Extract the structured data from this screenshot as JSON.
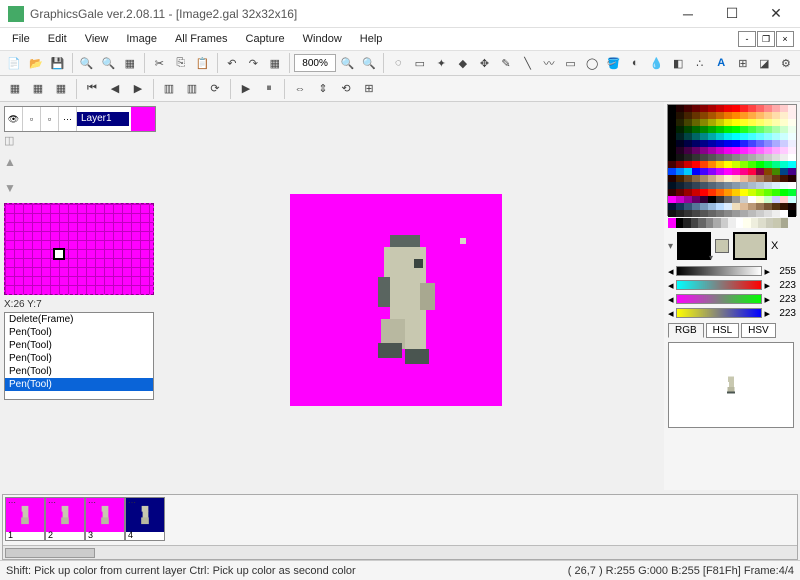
{
  "app": {
    "title": "GraphicsGale ver.2.08.11 - [Image2.gal 32x32x16]"
  },
  "menu": {
    "items": [
      "File",
      "Edit",
      "View",
      "Image",
      "All Frames",
      "Capture",
      "Window",
      "Help"
    ]
  },
  "toolbar": {
    "zoom": "800%"
  },
  "layer": {
    "name": "Layer1"
  },
  "minimap": {
    "coords": "X:26 Y:7"
  },
  "history": {
    "items": [
      "Delete(Frame)",
      "Pen(Tool)",
      "Pen(Tool)",
      "Pen(Tool)",
      "Pen(Tool)",
      "Pen(Tool)"
    ],
    "selected": 5
  },
  "sliders": {
    "rows": [
      {
        "val": "255",
        "grad": "linear-gradient(90deg,#000,#fff)"
      },
      {
        "val": "223",
        "grad": "linear-gradient(90deg,#0ff,#f00)"
      },
      {
        "val": "223",
        "grad": "linear-gradient(90deg,#f0f,#0f0)"
      },
      {
        "val": "223",
        "grad": "linear-gradient(90deg,#ff0,#00f)"
      }
    ]
  },
  "colortabs": {
    "items": [
      "RGB",
      "HSL",
      "HSV"
    ],
    "active": 0
  },
  "wells": {
    "fg": "#000000",
    "bg": "#c8c8b0",
    "x_label": "X"
  },
  "frames": {
    "count": 4,
    "selected": 4,
    "labels": [
      "1",
      "2",
      "3",
      "4"
    ]
  },
  "status": {
    "hint": "Shift: Pick up color from current layer  Ctrl: Pick up color as second color",
    "pos": "( 26,7 ) R:255 G:000 B:255  [F81Fh]  Frame:4/4"
  },
  "palette_colors": [
    "#000",
    "#200",
    "#400",
    "#600",
    "#800",
    "#a00",
    "#c00",
    "#e00",
    "#f00",
    "#f22",
    "#f44",
    "#f66",
    "#f88",
    "#faa",
    "#fcc",
    "#fee",
    "#000",
    "#210",
    "#420",
    "#630",
    "#840",
    "#a50",
    "#c60",
    "#e70",
    "#f80",
    "#f92",
    "#fa4",
    "#fb6",
    "#fc8",
    "#fda",
    "#fec",
    "#fee",
    "#000",
    "#220",
    "#440",
    "#660",
    "#880",
    "#aa0",
    "#cc0",
    "#ee0",
    "#ff0",
    "#ff2",
    "#ff4",
    "#ff6",
    "#ff8",
    "#ffa",
    "#ffc",
    "#ffe",
    "#000",
    "#020",
    "#040",
    "#060",
    "#080",
    "#0a0",
    "#0c0",
    "#0e0",
    "#0f0",
    "#2f2",
    "#4f4",
    "#6f6",
    "#8f8",
    "#afa",
    "#cfc",
    "#efe",
    "#000",
    "#022",
    "#044",
    "#066",
    "#088",
    "#0aa",
    "#0cc",
    "#0ee",
    "#0ff",
    "#2ff",
    "#4ff",
    "#6ff",
    "#8ff",
    "#aff",
    "#cff",
    "#eff",
    "#000",
    "#002",
    "#004",
    "#006",
    "#008",
    "#00a",
    "#00c",
    "#00e",
    "#00f",
    "#22f",
    "#44f",
    "#66f",
    "#88f",
    "#aaf",
    "#ccf",
    "#eef",
    "#000",
    "#202",
    "#404",
    "#606",
    "#808",
    "#a0a",
    "#c0c",
    "#e0e",
    "#f0f",
    "#f2f",
    "#f4f",
    "#f6f",
    "#f8f",
    "#faf",
    "#fcf",
    "#fef",
    "#000",
    "#111",
    "#222",
    "#333",
    "#444",
    "#555",
    "#666",
    "#777",
    "#888",
    "#999",
    "#aaa",
    "#bbb",
    "#ccc",
    "#ddd",
    "#eee",
    "#fff",
    "#400",
    "#800",
    "#c00",
    "#f00",
    "#f40",
    "#f80",
    "#fc0",
    "#ff0",
    "#cf0",
    "#8f0",
    "#4f0",
    "#0f0",
    "#0f4",
    "#0f8",
    "#0fc",
    "#0ff",
    "#04f",
    "#08f",
    "#0cf",
    "#00f",
    "#40f",
    "#80f",
    "#c0f",
    "#f0f",
    "#f0c",
    "#f08",
    "#f04",
    "#804",
    "#840",
    "#480",
    "#048",
    "#408",
    "#200",
    "#420",
    "#642",
    "#864",
    "#a86",
    "#ca8",
    "#eca",
    "#fec",
    "#fdb",
    "#eb9",
    "#c97",
    "#a75",
    "#853",
    "#631",
    "#410",
    "#200",
    "#012",
    "#123",
    "#234",
    "#345",
    "#456",
    "#567",
    "#678",
    "#789",
    "#89a",
    "#9ab",
    "#abc",
    "#bcd",
    "#cde",
    "#def",
    "#eff",
    "#fff",
    "#300",
    "#600",
    "#900",
    "#c00",
    "#f00",
    "#f30",
    "#f60",
    "#f90",
    "#fc0",
    "#ff0",
    "#cf0",
    "#9f0",
    "#6f0",
    "#3f0",
    "#0f0",
    "#0f3",
    "#f0f",
    "#c0c",
    "#909",
    "#606",
    "#303",
    "#000",
    "#333",
    "#666",
    "#999",
    "#ccc",
    "#fff",
    "#ffc",
    "#cfc",
    "#ccf",
    "#fcc",
    "#cff",
    "#013",
    "#135",
    "#357",
    "#579",
    "#79b",
    "#9bd",
    "#bdf",
    "#def",
    "#edb",
    "#db9",
    "#b97",
    "#975",
    "#753",
    "#531",
    "#310",
    "#100",
    "#111",
    "#222",
    "#333",
    "#444",
    "#555",
    "#666",
    "#777",
    "#888",
    "#999",
    "#aaa",
    "#bbb",
    "#ccc",
    "#ddd",
    "#eee",
    "#fff",
    "#000"
  ],
  "gray_row": [
    "#f0f",
    "#000",
    "#222",
    "#444",
    "#666",
    "#888",
    "#aaa",
    "#ccc",
    "#eee",
    "#fff",
    "#ffe",
    "#eed",
    "#ddc",
    "#ccb",
    "#c8c8b0",
    "#a8a890"
  ]
}
